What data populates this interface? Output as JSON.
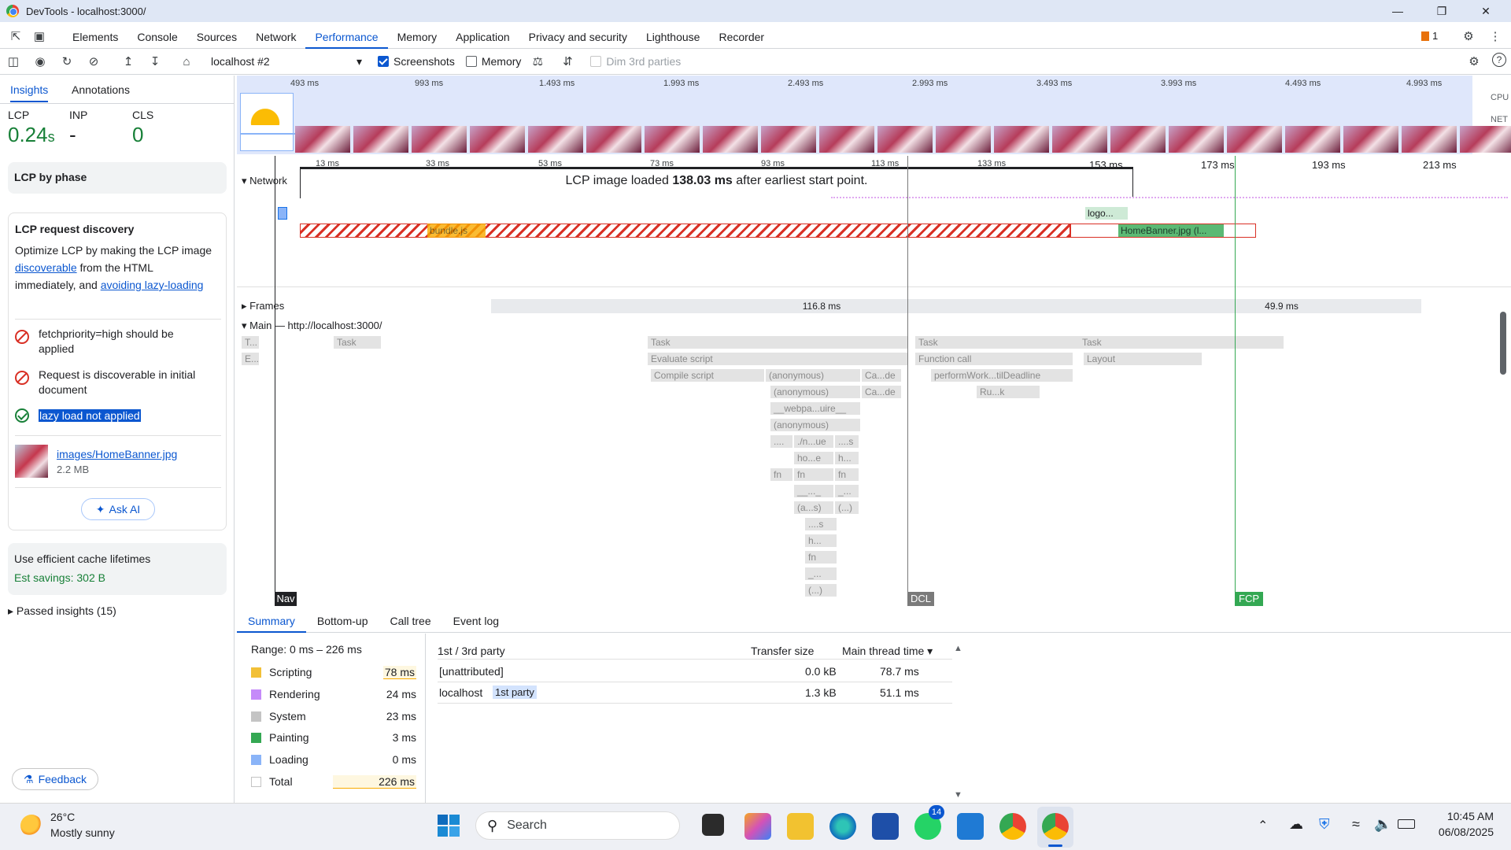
{
  "window": {
    "title": "DevTools - localhost:3000/"
  },
  "tabs": [
    "Elements",
    "Console",
    "Sources",
    "Network",
    "Performance",
    "Memory",
    "Application",
    "Privacy and security",
    "Lighthouse",
    "Recorder"
  ],
  "active_tab": "Performance",
  "issues_count": "1",
  "toolbar": {
    "session": "localhost #2",
    "screenshots_label": "Screenshots",
    "memory_label": "Memory",
    "dim3p_label": "Dim 3rd parties"
  },
  "sidebar": {
    "tabs": [
      "Insights",
      "Annotations"
    ],
    "metrics": [
      {
        "label": "LCP",
        "value": "0.24",
        "unit": "s"
      },
      {
        "label": "INP",
        "value": "-"
      },
      {
        "label": "CLS",
        "value": "0"
      }
    ],
    "lcp_phase_title": "LCP by phase",
    "discovery": {
      "title": "LCP request discovery",
      "desc_a": "Optimize LCP by making the LCP image",
      "link1": "discoverable",
      "desc_b": " from the HTML",
      "desc_c": "immediately, and ",
      "link2": "avoiding lazy-loading",
      "checks": [
        {
          "text": "fetchpriority=high should be applied",
          "status": "fail"
        },
        {
          "text": "Request is discoverable in initial document",
          "status": "fail"
        },
        {
          "text": "lazy load not applied",
          "status": "pass"
        }
      ],
      "image_link": "images/HomeBanner.jpg",
      "image_size": "2.2 MB",
      "ask_ai": "Ask AI"
    },
    "cache": {
      "title": "Use efficient cache lifetimes",
      "savings": "Est savings: 302 B"
    },
    "passed": "Passed insights (15)",
    "feedback": "Feedback"
  },
  "overview": {
    "ticks": [
      "493 ms",
      "993 ms",
      "1.493 ms",
      "1.993 ms",
      "2.493 ms",
      "2.993 ms",
      "3.493 ms",
      "3.993 ms",
      "4.493 ms",
      "4.993 ms"
    ],
    "cpu": "CPU",
    "net": "NET"
  },
  "timeline": {
    "ticks": [
      "13 ms",
      "33 ms",
      "53 ms",
      "73 ms",
      "93 ms",
      "113 ms",
      "133 ms",
      "153 ms",
      "173 ms",
      "193 ms",
      "213 ms"
    ],
    "network_label": "Network",
    "lcp_banner_a": "LCP image loaded ",
    "lcp_banner_b": "138.03 ms",
    "lcp_banner_c": " after earliest start point.",
    "requests": [
      "bundle.js",
      "logo...",
      "HomeBanner.jpg (l..."
    ],
    "frames_label": "Frames",
    "frame_values": [
      "116.8 ms",
      "49.9 ms"
    ],
    "main_label": "Main — http://localhost:3000/",
    "markers": [
      "Nav",
      "DCL",
      "FCP"
    ],
    "flames": [
      "T...",
      "Task",
      "E...",
      "Task",
      "Evaluate script",
      "Compile script",
      "(anonymous)",
      "Ca...de",
      "(anonymous)",
      "Ca...de",
      "__webpa...uire__",
      "(anonymous)",
      "....",
      "./n...ue",
      "....s",
      "ho...e",
      "h...",
      "fn",
      "fn",
      "fn",
      "__..._",
      "_...",
      "(a...s)",
      "(...)",
      "....s",
      "h...",
      "fn",
      "_...",
      "(...)",
      "Task",
      "Function call",
      "performWork...tilDeadline",
      "Ru...k",
      "Task",
      "Layout"
    ]
  },
  "bottom": {
    "tabs": [
      "Summary",
      "Bottom-up",
      "Call tree",
      "Event log"
    ],
    "range": "Range: 0 ms – 226 ms",
    "rows": [
      {
        "label": "Scripting",
        "value": "78 ms",
        "color": "#f2c037"
      },
      {
        "label": "Rendering",
        "value": "24 ms",
        "color": "#c58af9"
      },
      {
        "label": "System",
        "value": "23 ms",
        "color": "#c4c4c4"
      },
      {
        "label": "Painting",
        "value": "3 ms",
        "color": "#34a853"
      },
      {
        "label": "Loading",
        "value": "0 ms",
        "color": "#8ab4f8"
      },
      {
        "label": "Total",
        "value": "226 ms",
        "color": "#ffffff"
      }
    ],
    "table": {
      "headers": [
        "1st / 3rd party",
        "Transfer size",
        "Main thread time"
      ],
      "rows": [
        {
          "name": "[unattributed]",
          "badge": "",
          "size": "0.0 kB",
          "time": "78.7 ms"
        },
        {
          "name": "localhost",
          "badge": "1st party",
          "size": "1.3 kB",
          "time": "51.1 ms"
        }
      ]
    }
  },
  "taskbar": {
    "weather_temp": "26°C",
    "weather_desc": "Mostly sunny",
    "search": "Search",
    "badge": "14",
    "time": "10:45 AM",
    "date": "06/08/2025"
  }
}
